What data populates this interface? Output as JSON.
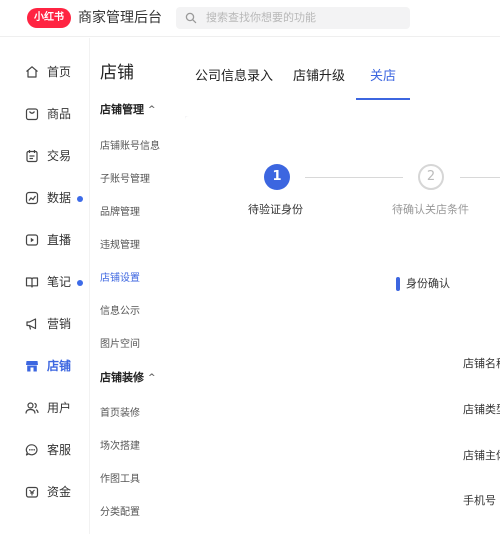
{
  "header": {
    "logo_text": "小红书",
    "app_title": "商家管理后台",
    "search_placeholder": "搜索查找你想要的功能",
    "brand_color": "#ff2442",
    "accent_color": "#3c66e0"
  },
  "nav": {
    "items": [
      {
        "label": "首页",
        "icon": "home-icon"
      },
      {
        "label": "商品",
        "icon": "product-icon"
      },
      {
        "label": "交易",
        "icon": "trade-icon"
      },
      {
        "label": "数据",
        "icon": "chart-icon",
        "badge": true
      },
      {
        "label": "直播",
        "icon": "live-icon"
      },
      {
        "label": "笔记",
        "icon": "book-icon",
        "badge": true
      },
      {
        "label": "营销",
        "icon": "megaphone-icon"
      },
      {
        "label": "店铺",
        "icon": "store-icon",
        "active": true
      },
      {
        "label": "用户",
        "icon": "users-icon"
      },
      {
        "label": "客服",
        "icon": "chat-icon"
      },
      {
        "label": "资金",
        "icon": "wallet-icon"
      }
    ]
  },
  "subnav": {
    "title": "店铺",
    "group1": {
      "label": "店铺管理",
      "caret": "^"
    },
    "group1_items": [
      "店铺账号信息",
      "子账号管理",
      "品牌管理",
      "违规管理",
      "店铺设置",
      "信息公示",
      "图片空间"
    ],
    "group2": {
      "label": "店铺装修",
      "caret": "^"
    },
    "group2_items": [
      "首页装修",
      "场次搭建",
      "作图工具",
      "分类配置"
    ]
  },
  "tabs": [
    "公司信息录入",
    "店铺升级",
    "关店"
  ],
  "steps": [
    {
      "number": "1",
      "label": "待验证身份"
    },
    {
      "number": "2",
      "label": "待确认关店条件"
    }
  ],
  "section": {
    "title": "身份确认"
  },
  "fields": [
    "店铺名称",
    "店铺类型",
    "店铺主体",
    "手机号"
  ]
}
